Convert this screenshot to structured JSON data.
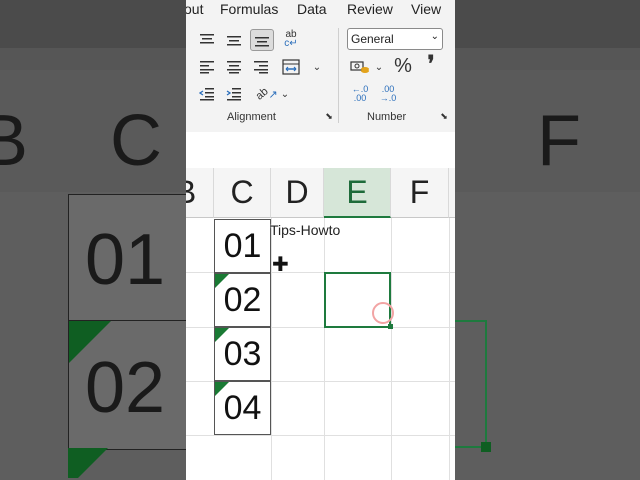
{
  "ribbon": {
    "tabs": [
      "out",
      "Formulas",
      "Data",
      "Review",
      "View"
    ],
    "alignment_label": "Alignment",
    "number_label": "Number",
    "number_format": "General",
    "percent_symbol": "%",
    "comma_symbol": "❜",
    "increase_decimal_label": "←.0 .00",
    "decrease_decimal_label": ".00 →.0"
  },
  "grid": {
    "column_headers": [
      "B",
      "C",
      "D",
      "E",
      "F"
    ],
    "selected_column": "E",
    "cells": [
      "01",
      "02",
      "03",
      "04"
    ],
    "active_cell": "E3"
  },
  "overlay": {
    "watermark": "Tips-Howto"
  },
  "background_zoom": {
    "headers": [
      "B",
      "C",
      "F"
    ],
    "cells": [
      "01",
      "02"
    ]
  },
  "colors": {
    "accent_green": "#1e7a3e",
    "error_triangle": "#1a7a34"
  }
}
